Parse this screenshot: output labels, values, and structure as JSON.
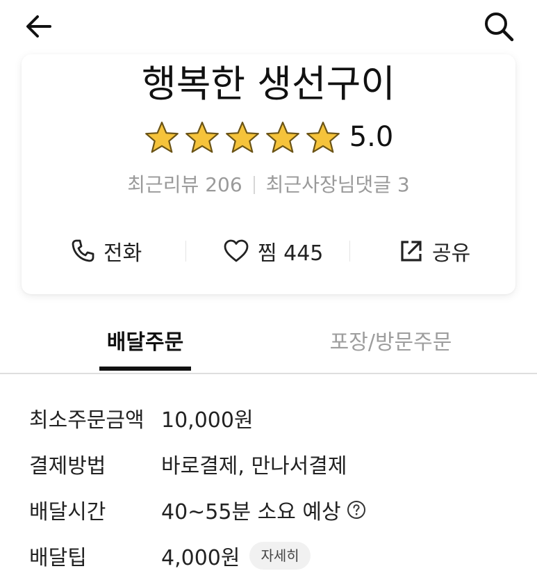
{
  "topbar": {
    "back_icon": "arrow-left-icon",
    "search_icon": "search-icon"
  },
  "store": {
    "name": "행복한 생선구이",
    "rating": "5.0",
    "stars_filled": 5,
    "stars_total": 5,
    "star_color": "#f5c33b",
    "recent_reviews": "최근리뷰 206",
    "owner_comments": "최근사장님댓글 3"
  },
  "actions": {
    "call": {
      "icon": "phone-icon",
      "label": "전화"
    },
    "like": {
      "icon": "heart-icon",
      "label": "찜 445"
    },
    "share": {
      "icon": "share-icon",
      "label": "공유"
    }
  },
  "tabs": [
    {
      "label": "배달주문",
      "active": true
    },
    {
      "label": "포장/방문주문",
      "active": false
    }
  ],
  "info": {
    "min_order": {
      "label": "최소주문금액",
      "value": "10,000원"
    },
    "payment": {
      "label": "결제방법",
      "value": "바로결제, 만나서결제"
    },
    "delivery_time": {
      "label": "배달시간",
      "value": "40~55분 소요 예상"
    },
    "delivery_tip": {
      "label": "배달팁",
      "value": "4,000원",
      "detail_button": "자세히"
    }
  }
}
